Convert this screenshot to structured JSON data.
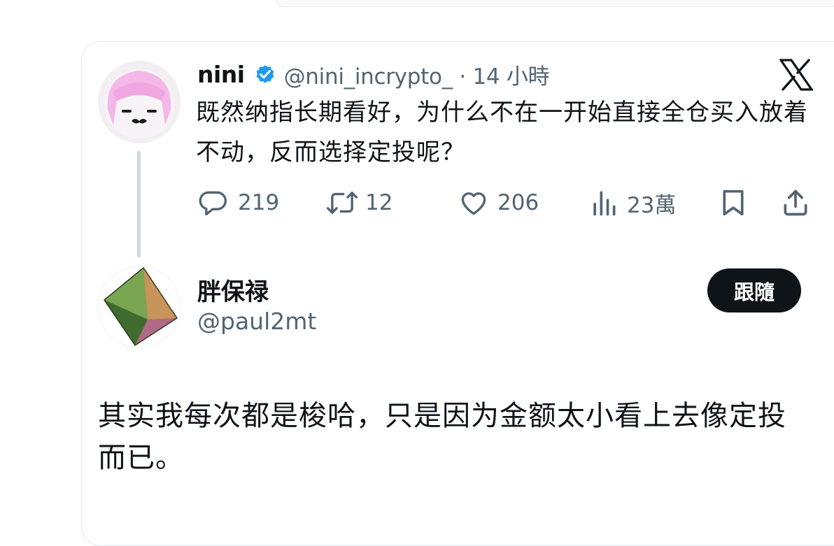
{
  "parent_tweet": {
    "author_name": "nini",
    "author_handle_time": "@nini_incrypto_ · 14 小時",
    "text": "既然纳指长期看好，为什么不在一开始直接全仓买入放着不动，反而选择定投呢？",
    "actions": {
      "replies": "219",
      "retweets": "12",
      "likes": "206",
      "views": "23萬"
    },
    "icons": {
      "verified": "verified-badge-icon",
      "platform": "x-logo-icon",
      "reply": "reply-bubble-icon",
      "retweet": "retweet-icon",
      "like": "heart-icon",
      "views": "bar-chart-icon",
      "bookmark": "bookmark-icon",
      "share": "share-icon"
    },
    "verified_color": "#1d9bf0"
  },
  "reply": {
    "author_name": "胖保禄",
    "author_handle": "@paul2mt",
    "follow_label": "跟隨",
    "text": "其实我每次都是梭哈，只是因为金额太小看上去像定投而已。"
  },
  "colors": {
    "text_primary": "#0f1419",
    "text_secondary": "#536471",
    "thread_line": "#cfd9de",
    "button_bg": "#0f1419"
  }
}
